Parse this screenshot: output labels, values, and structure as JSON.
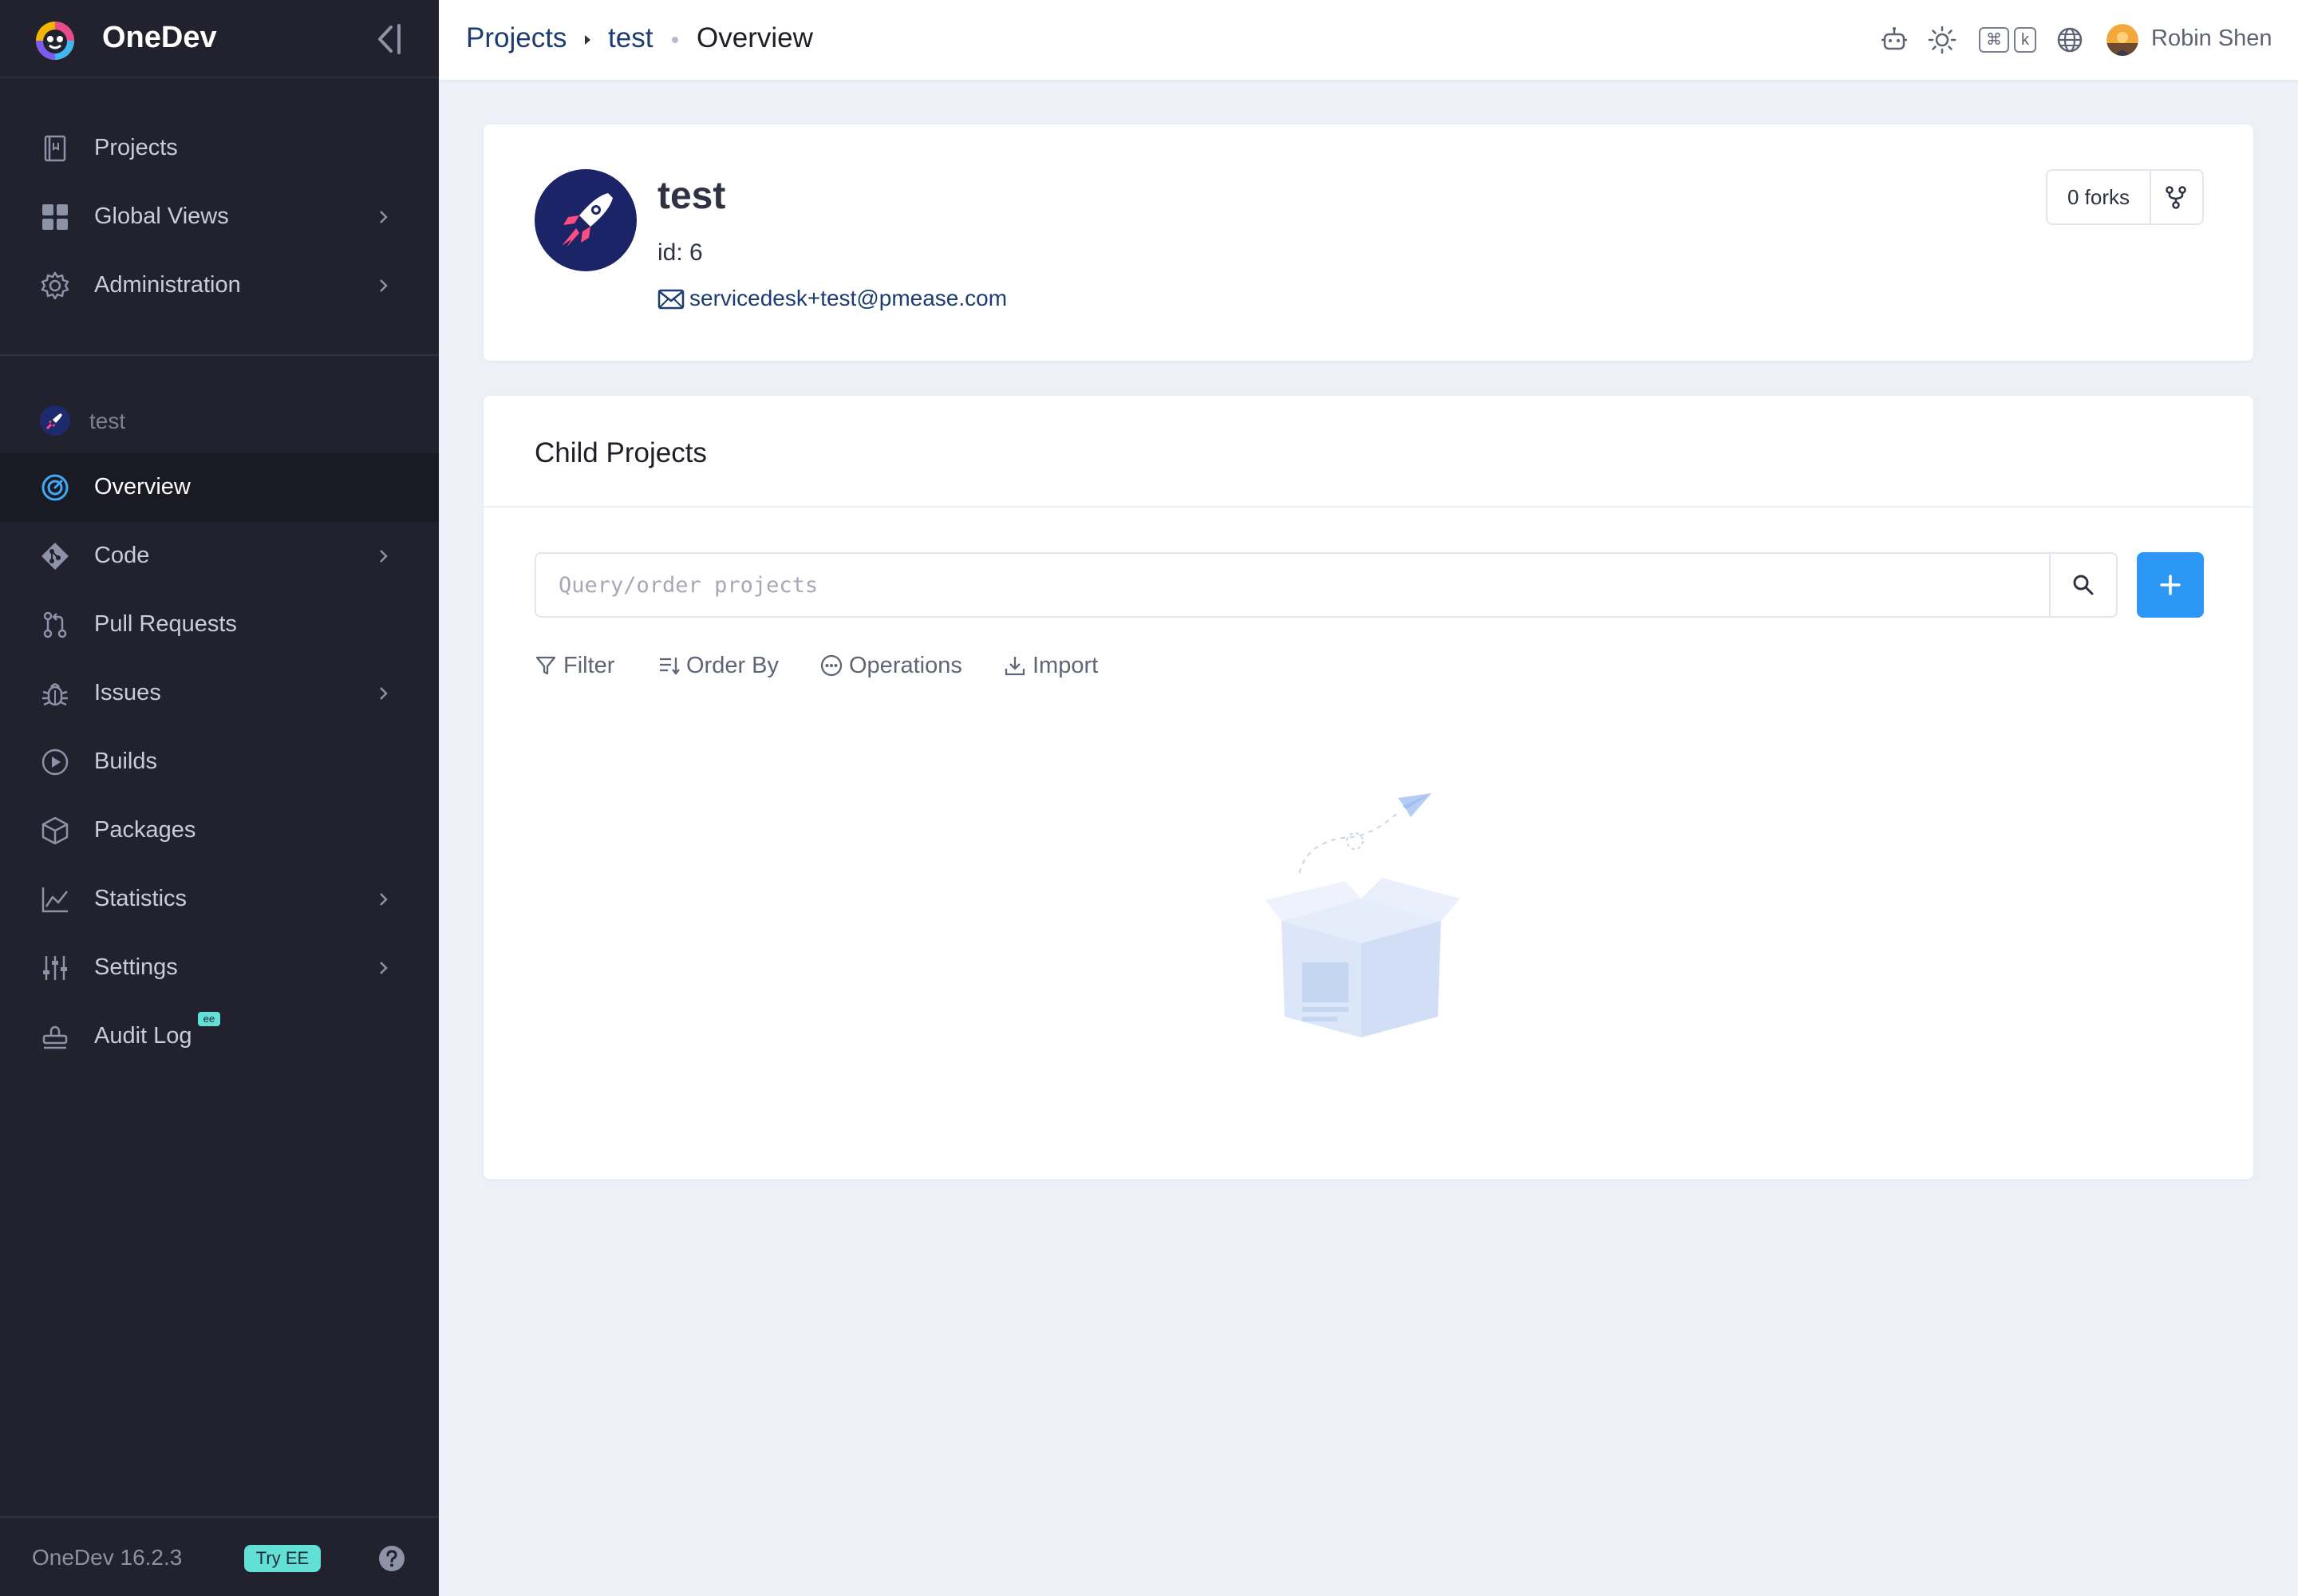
{
  "app": {
    "name": "OneDev",
    "version": "OneDev 16.2.3",
    "try_ee": "Try EE",
    "accent": "#2c97f5",
    "sidebar_bg": "#21222e"
  },
  "sidebar": {
    "global_items": [
      {
        "label": "Projects",
        "icon": "book-icon"
      },
      {
        "label": "Global Views",
        "icon": "grid-icon",
        "has_submenu": true
      },
      {
        "label": "Administration",
        "icon": "gear-icon",
        "has_submenu": true
      }
    ],
    "project_label": "test",
    "project_items": [
      {
        "label": "Overview",
        "icon": "gauge-icon",
        "active": true
      },
      {
        "label": "Code",
        "icon": "git-icon",
        "has_submenu": true
      },
      {
        "label": "Pull Requests",
        "icon": "pull-request-icon"
      },
      {
        "label": "Issues",
        "icon": "bug-icon",
        "has_submenu": true
      },
      {
        "label": "Builds",
        "icon": "play-icon"
      },
      {
        "label": "Packages",
        "icon": "package-icon"
      },
      {
        "label": "Statistics",
        "icon": "chart-line-icon",
        "has_submenu": true
      },
      {
        "label": "Settings",
        "icon": "sliders-icon",
        "has_submenu": true
      },
      {
        "label": "Audit Log",
        "icon": "stamp-icon",
        "badge": "ee"
      }
    ]
  },
  "topbar": {
    "breadcrumbs": [
      "Projects",
      "test",
      "Overview"
    ],
    "user_name": "Robin Shen",
    "shortcut_keys": [
      "⌘",
      "k"
    ]
  },
  "project": {
    "name": "test",
    "id_text": "id: 6",
    "email": "servicedesk+test@pmease.com",
    "forks_label": "0 forks"
  },
  "child_projects": {
    "title": "Child Projects",
    "search_placeholder": "Query/order projects",
    "tools": [
      "Filter",
      "Order By",
      "Operations",
      "Import"
    ]
  }
}
